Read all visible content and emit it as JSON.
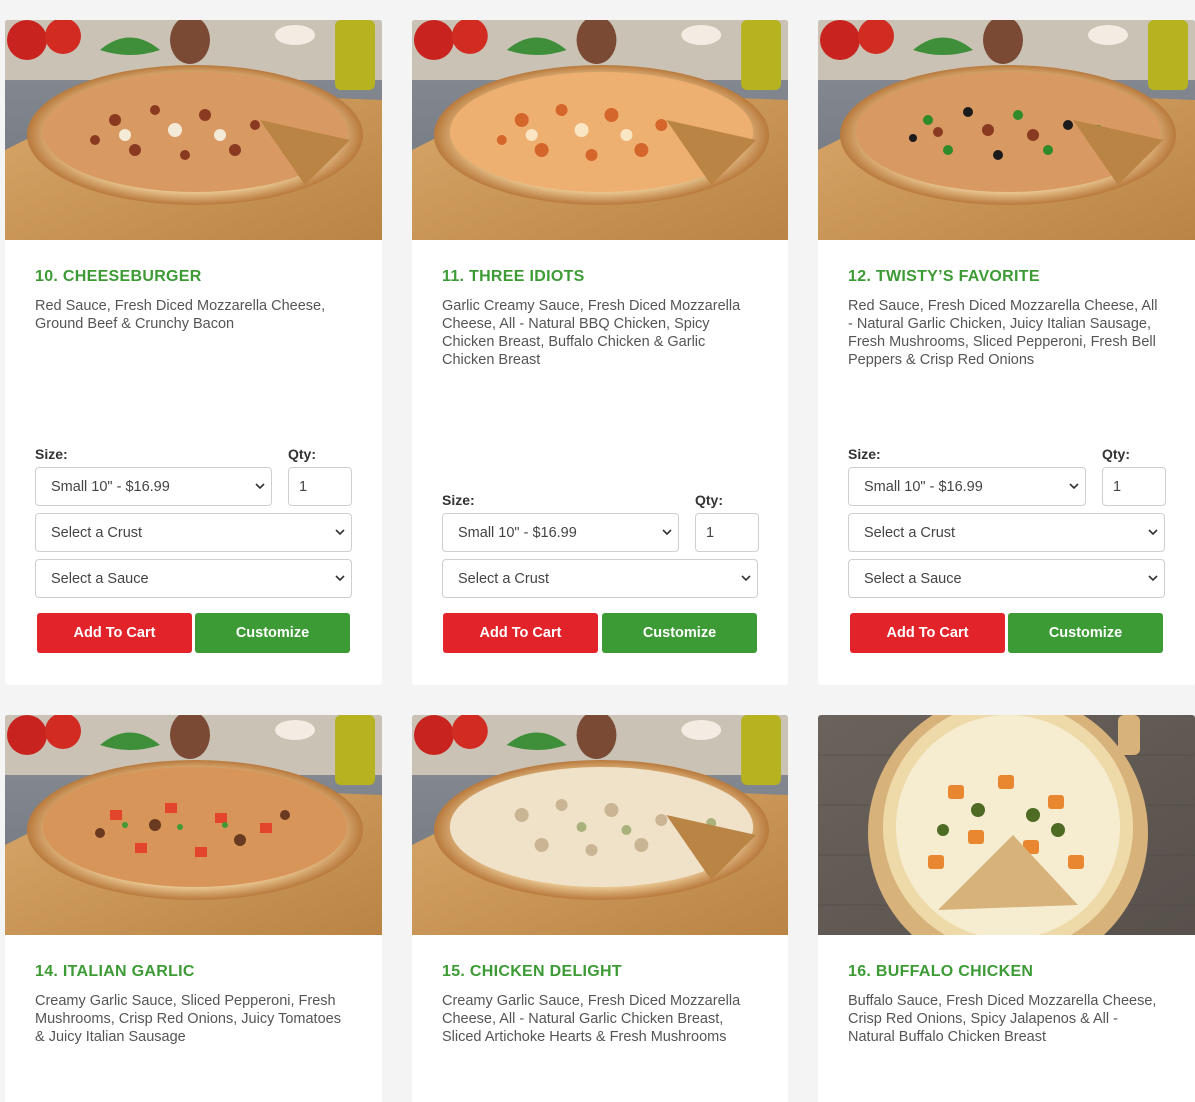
{
  "products": [
    {
      "title": "10. CHEESEBURGER",
      "description": "Red Sauce, Fresh Diced Mozzarella Cheese, Ground Beef & Crunchy Bacon",
      "size_label": "Size:",
      "qty_label": "Qty:",
      "size_value": "Small 10\" - $16.99",
      "qty_value": "1",
      "crust_value": "Select a Crust",
      "sauce_value": "Select a Sauce",
      "add_label": "Add To Cart",
      "customize_label": "Customize"
    },
    {
      "title": "11. THREE IDIOTS",
      "description": "Garlic Creamy Sauce, Fresh Diced Mozzarella Cheese, All - Natural BBQ Chicken, Spicy Chicken Breast, Buffalo Chicken & Garlic Chicken Breast",
      "size_label": "Size:",
      "qty_label": "Qty:",
      "size_value": "Small 10\" - $16.99",
      "qty_value": "1",
      "crust_value": "Select a Crust",
      "add_label": "Add To Cart",
      "customize_label": "Customize"
    },
    {
      "title": "12. TWISTY’S FAVORITE",
      "description": "Red Sauce, Fresh Diced Mozzarella Cheese, All - Natural Garlic Chicken, Juicy Italian Sausage, Fresh Mushrooms, Sliced Pepperoni, Fresh Bell Peppers & Crisp Red Onions",
      "size_label": "Size:",
      "qty_label": "Qty:",
      "size_value": "Small 10\" - $16.99",
      "qty_value": "1",
      "crust_value": "Select a Crust",
      "sauce_value": "Select a Sauce",
      "add_label": "Add To Cart",
      "customize_label": "Customize"
    },
    {
      "title": "14. ITALIAN GARLIC",
      "description": "Creamy Garlic Sauce, Sliced Pepperoni, Fresh Mushrooms, Crisp Red Onions, Juicy Tomatoes & Juicy Italian Sausage"
    },
    {
      "title": "15. CHICKEN DELIGHT",
      "description": "Creamy Garlic Sauce, Fresh Diced Mozzarella Cheese, All - Natural Garlic Chicken Breast, Sliced Artichoke Hearts & Fresh Mushrooms"
    },
    {
      "title": "16. BUFFALO CHICKEN",
      "description": "Buffalo Sauce, Fresh Diced Mozzarella Cheese, Crisp Red Onions, Spicy Jalapenos & All - Natural Buffalo Chicken Breast"
    }
  ],
  "icons": {
    "select_arrow": "chevron-down-icon"
  },
  "colors": {
    "title_green": "#3d9b35",
    "add_red": "#e2232a",
    "customize_green": "#3d9b35"
  }
}
